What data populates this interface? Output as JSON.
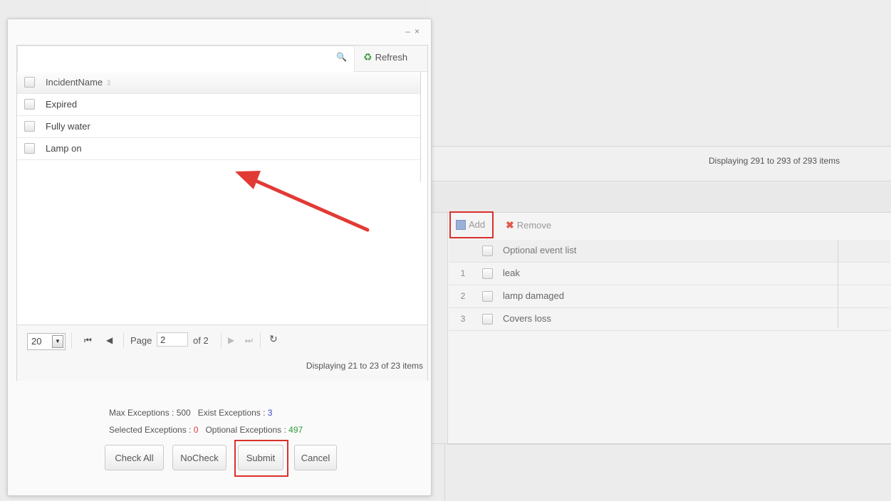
{
  "background": {
    "status_text": "Displaying 291 to 293 of 293 items",
    "toolbar": {
      "add_label": "Add",
      "remove_label": "Remove"
    },
    "grid": {
      "header": "Optional event list",
      "rows": [
        {
          "num": "1",
          "name": "leak"
        },
        {
          "num": "2",
          "name": "lamp damaged"
        },
        {
          "num": "3",
          "name": "Covers loss"
        }
      ]
    }
  },
  "dialog": {
    "controls": "– ×",
    "search": {
      "placeholder": ""
    },
    "refresh_label": "Refresh",
    "grid": {
      "header": "IncidentName",
      "rows": [
        {
          "name": "Expired"
        },
        {
          "name": "Fully water"
        },
        {
          "name": "Lamp on"
        }
      ]
    },
    "pager": {
      "page_size": "20",
      "page_label": "Page",
      "page_value": "2",
      "of_label": "of 2",
      "status": "Displaying 21 to 23 of 23 items"
    },
    "stats": {
      "max_label": "Max Exceptions : 500",
      "exist_label": "Exist Exceptions : ",
      "exist_value": "3",
      "selected_label": "Selected Exceptions : ",
      "selected_value": "0",
      "optional_label": "Optional Exceptions : ",
      "optional_value": "497"
    },
    "buttons": {
      "check_all": "Check All",
      "no_check": "NoCheck",
      "submit": "Submit",
      "cancel": "Cancel"
    }
  },
  "colors": {
    "highlight": "#d9302c",
    "arrow": "#e23a35"
  }
}
